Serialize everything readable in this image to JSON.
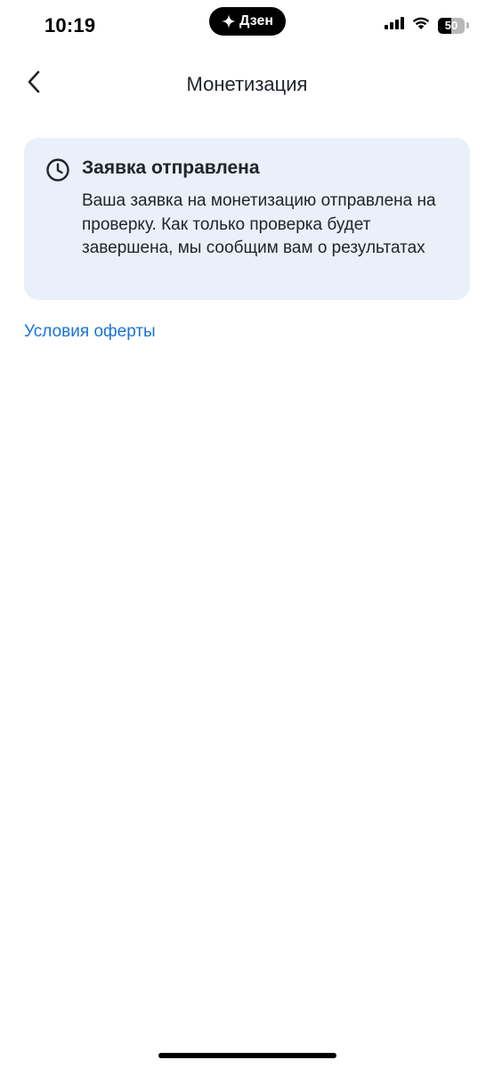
{
  "status_bar": {
    "time": "10:19",
    "island_label": "Дзен",
    "battery_level": "50",
    "battery_percent": 50
  },
  "header": {
    "title": "Монетизация"
  },
  "card": {
    "title": "Заявка отправлена",
    "text": "Ваша заявка на монетизацию отправлена на проверку. Как только проверка будет завершена, мы сообщим вам о результатах",
    "background_color": "#e9f0f9"
  },
  "links": {
    "terms_label": "Условия оферты",
    "link_color": "#1a73d9"
  },
  "icons": {
    "back": "chevron-left-icon",
    "clock": "clock-icon",
    "island": "sparkle-icon",
    "signal": "cellular-signal-icon",
    "wifi": "wifi-icon",
    "battery": "battery-icon"
  }
}
